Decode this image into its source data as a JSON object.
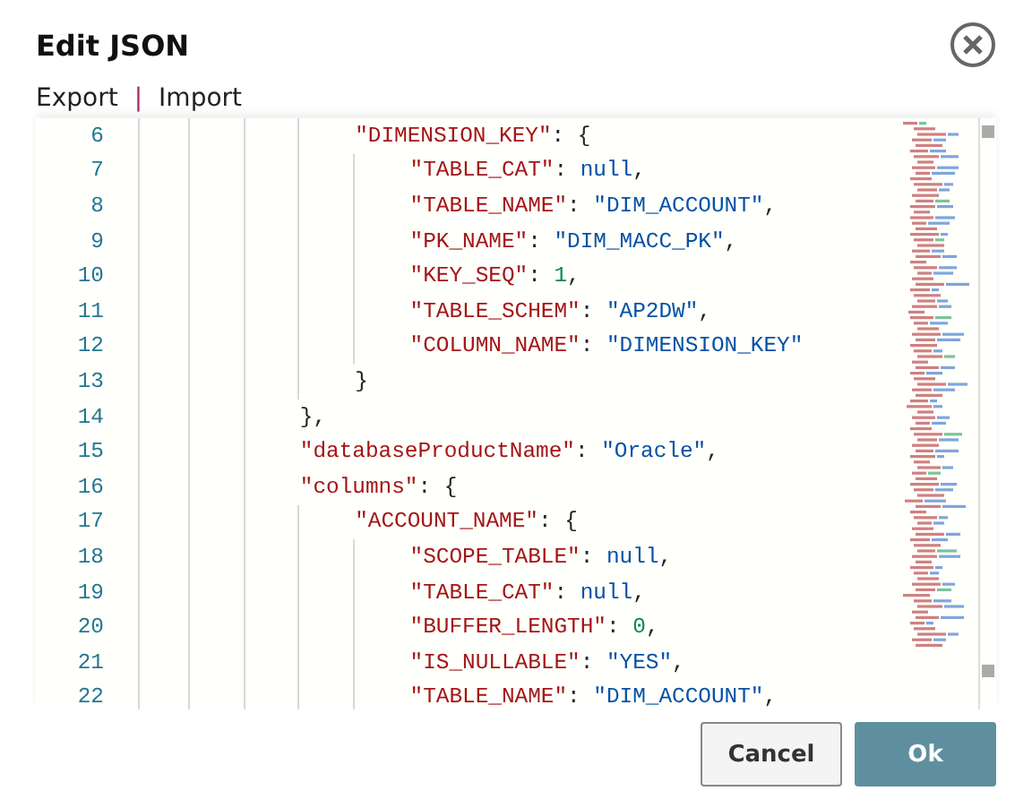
{
  "dialog": {
    "title": "Edit JSON"
  },
  "menu": [
    {
      "label": "Export"
    },
    {
      "label": "Import"
    }
  ],
  "separator": "|",
  "editor": {
    "lines": [
      {
        "children": [
          {
            "number": "6",
            "tokens": [
              {
                "kind": "key",
                "text": "\"DIMENSION_KEY\""
              },
              {
                "kind": "punct",
                "text": ": {"
              }
            ],
            "children": [
              {
                "number": "7",
                "tokens": [
                  {
                    "kind": "key",
                    "text": "\"TABLE_CAT\""
                  },
                  {
                    "kind": "punct",
                    "text": ": "
                  },
                  {
                    "kind": "null",
                    "text": "null"
                  },
                  {
                    "kind": "punct",
                    "text": ","
                  }
                ]
              },
              {
                "number": "8",
                "tokens": [
                  {
                    "kind": "key",
                    "text": "\"TABLE_NAME\""
                  },
                  {
                    "kind": "punct",
                    "text": ": "
                  },
                  {
                    "kind": "string",
                    "text": "\"DIM_ACCOUNT\""
                  },
                  {
                    "kind": "punct",
                    "text": ","
                  }
                ]
              },
              {
                "number": "9",
                "tokens": [
                  {
                    "kind": "key",
                    "text": "\"PK_NAME\""
                  },
                  {
                    "kind": "punct",
                    "text": ": "
                  },
                  {
                    "kind": "string",
                    "text": "\"DIM_MACC_PK\""
                  },
                  {
                    "kind": "punct",
                    "text": ","
                  }
                ]
              },
              {
                "number": "10",
                "tokens": [
                  {
                    "kind": "key",
                    "text": "\"KEY_SEQ\""
                  },
                  {
                    "kind": "punct",
                    "text": ": "
                  },
                  {
                    "kind": "number",
                    "text": "1"
                  },
                  {
                    "kind": "punct",
                    "text": ","
                  }
                ]
              },
              {
                "number": "11",
                "tokens": [
                  {
                    "kind": "key",
                    "text": "\"TABLE_SCHEM\""
                  },
                  {
                    "kind": "punct",
                    "text": ": "
                  },
                  {
                    "kind": "string",
                    "text": "\"AP2DW\""
                  },
                  {
                    "kind": "punct",
                    "text": ","
                  }
                ]
              },
              {
                "number": "12",
                "tokens": [
                  {
                    "kind": "key",
                    "text": "\"COLUMN_NAME\""
                  },
                  {
                    "kind": "punct",
                    "text": ": "
                  },
                  {
                    "kind": "string",
                    "text": "\"DIMENSION_KEY\""
                  }
                ]
              }
            ]
          },
          {
            "number": "13",
            "tokens": [
              {
                "kind": "punct",
                "text": "}"
              }
            ]
          }
        ]
      },
      {
        "number": "14",
        "tokens": [
          {
            "kind": "punct",
            "text": "},"
          }
        ]
      },
      {
        "number": "15",
        "tokens": [
          {
            "kind": "key",
            "text": "\"databaseProductName\""
          },
          {
            "kind": "punct",
            "text": ": "
          },
          {
            "kind": "string",
            "text": "\"Oracle\""
          },
          {
            "kind": "punct",
            "text": ","
          }
        ]
      },
      {
        "number": "16",
        "tokens": [
          {
            "kind": "key",
            "text": "\"columns\""
          },
          {
            "kind": "punct",
            "text": ": {"
          }
        ],
        "children": [
          {
            "number": "17",
            "tokens": [
              {
                "kind": "key",
                "text": "\"ACCOUNT_NAME\""
              },
              {
                "kind": "punct",
                "text": ": {"
              }
            ],
            "children": [
              {
                "number": "18",
                "tokens": [
                  {
                    "kind": "key",
                    "text": "\"SCOPE_TABLE\""
                  },
                  {
                    "kind": "punct",
                    "text": ": "
                  },
                  {
                    "kind": "null",
                    "text": "null"
                  },
                  {
                    "kind": "punct",
                    "text": ","
                  }
                ]
              },
              {
                "number": "19",
                "tokens": [
                  {
                    "kind": "key",
                    "text": "\"TABLE_CAT\""
                  },
                  {
                    "kind": "punct",
                    "text": ": "
                  },
                  {
                    "kind": "null",
                    "text": "null"
                  },
                  {
                    "kind": "punct",
                    "text": ","
                  }
                ]
              },
              {
                "number": "20",
                "tokens": [
                  {
                    "kind": "key",
                    "text": "\"BUFFER_LENGTH\""
                  },
                  {
                    "kind": "punct",
                    "text": ": "
                  },
                  {
                    "kind": "number",
                    "text": "0"
                  },
                  {
                    "kind": "punct",
                    "text": ","
                  }
                ]
              },
              {
                "number": "21",
                "tokens": [
                  {
                    "kind": "key",
                    "text": "\"IS_NULLABLE\""
                  },
                  {
                    "kind": "punct",
                    "text": ": "
                  },
                  {
                    "kind": "string",
                    "text": "\"YES\""
                  },
                  {
                    "kind": "punct",
                    "text": ","
                  }
                ]
              },
              {
                "number": "22",
                "tokens": [
                  {
                    "kind": "key",
                    "text": "\"TABLE_NAME\""
                  },
                  {
                    "kind": "punct",
                    "text": ": "
                  },
                  {
                    "kind": "string",
                    "text": "\"DIM_ACCOUNT\""
                  },
                  {
                    "kind": "punct",
                    "text": ","
                  }
                ]
              }
            ]
          }
        ]
      }
    ]
  },
  "buttons": [
    {
      "label": "Cancel",
      "kind": "secondary"
    },
    {
      "label": "Ok",
      "kind": "primary"
    }
  ]
}
